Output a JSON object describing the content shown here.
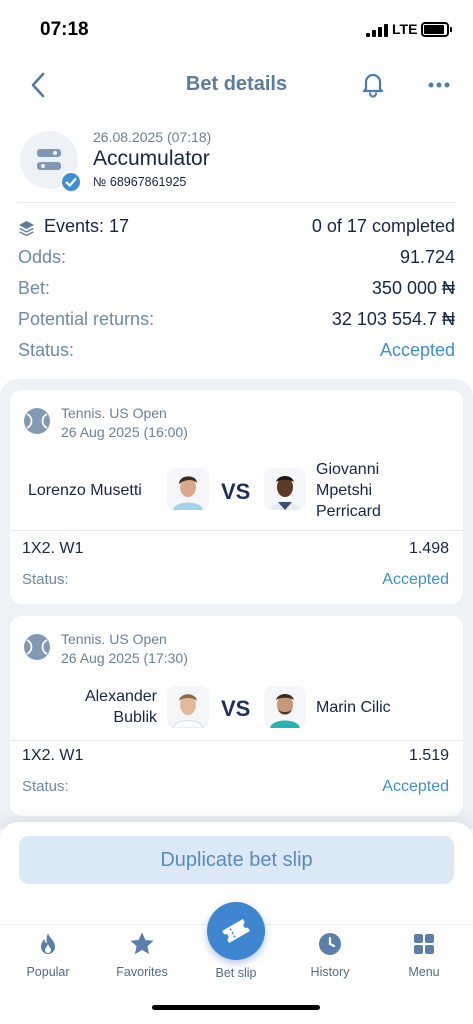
{
  "status_bar": {
    "time": "07:18",
    "network": "LTE"
  },
  "header": {
    "title": "Bet details"
  },
  "summary": {
    "date": "26.08.2025 (07:18)",
    "type": "Accumulator",
    "number": "№ 68967861925"
  },
  "info": {
    "events_label": "Events: 17",
    "events_completed": "0 of 17 completed",
    "odds_label": "Odds:",
    "odds_value": "91.724",
    "bet_label": "Bet:",
    "bet_value": "350 000 ₦",
    "returns_label": "Potential returns:",
    "returns_value": "32 103 554.7 ₦",
    "status_label": "Status:",
    "status_value": "Accepted"
  },
  "events": [
    {
      "league": "Tennis. US Open",
      "time": "26 Aug 2025 (16:00)",
      "player1": "Lorenzo Musetti",
      "vs": "VS",
      "player2_line1": "Giovanni",
      "player2_line2": "Mpetshi",
      "player2_line3": "Perricard",
      "market": "1X2. W1",
      "odd": "1.498",
      "status_label": "Status:",
      "status_value": "Accepted"
    },
    {
      "league": "Tennis. US Open",
      "time": "26 Aug 2025 (17:30)",
      "player1_line1": "Alexander",
      "player1_line2": "Bublik",
      "vs": "VS",
      "player2": "Marin Cilic",
      "market": "1X2. W1",
      "odd": "1.519",
      "status_label": "Status:",
      "status_value": "Accepted"
    }
  ],
  "actions": {
    "duplicate_label": "Duplicate bet slip"
  },
  "tabbar": {
    "popular": "Popular",
    "favorites": "Favorites",
    "bet_slip": "Bet slip",
    "history": "History",
    "menu": "Menu"
  },
  "colors": {
    "accent": "#3f86d0",
    "label": "#6a8bab",
    "text": "#15264a",
    "background_list": "#eef2f7"
  }
}
